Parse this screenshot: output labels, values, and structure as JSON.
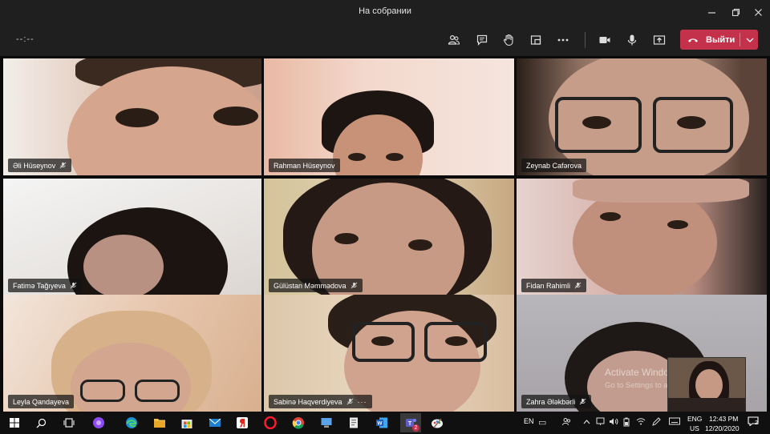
{
  "window": {
    "title": "На собрании"
  },
  "toolbar": {
    "timer": "--:--",
    "leave_label": "Выйти"
  },
  "participants": [
    {
      "name": "Əli Hüseynov"
    },
    {
      "name": "Rahman Hüseynov"
    },
    {
      "name": "Zeynab Cafərova"
    },
    {
      "name": "Fatimə Tağıyeva"
    },
    {
      "name": "Gülüstan Məmmədova"
    },
    {
      "name": "Fidan Rahimli"
    },
    {
      "name": "Leyla Qandayeva"
    },
    {
      "name": "Sabinə Haqverdiyeva",
      "more": "···"
    },
    {
      "name": "Zahra Ələkbərli"
    }
  ],
  "watermark": {
    "line1": "Activate Windows",
    "line2": "Go to Settings to activate Windows."
  },
  "taskbar": {
    "language": "EN",
    "input_lang": "ENG",
    "input_region": "US",
    "time": "12:43 PM",
    "date": "12/20/2020",
    "teams_badge": "2",
    "notifications": "2"
  },
  "colors": {
    "leave": "#c4314b",
    "chrome": "#1f1f1f",
    "taskbar": "#101010"
  }
}
